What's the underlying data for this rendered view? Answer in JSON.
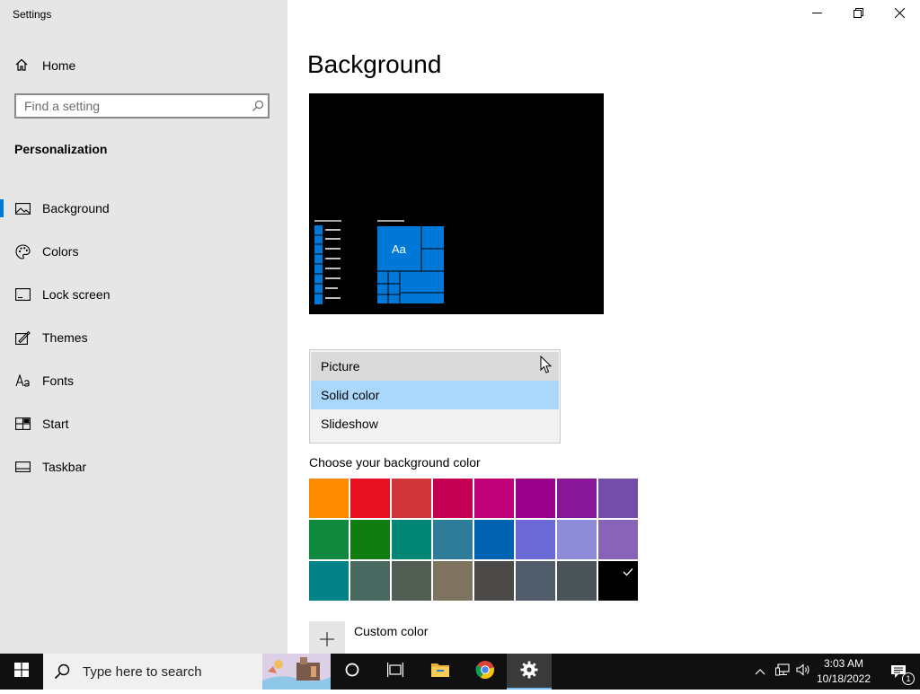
{
  "window": {
    "title": "Settings"
  },
  "sidebar": {
    "home_label": "Home",
    "search_placeholder": "Find a setting",
    "section_title": "Personalization",
    "items": [
      {
        "label": "Background",
        "icon": "picture-icon",
        "active": true
      },
      {
        "label": "Colors",
        "icon": "palette-icon",
        "active": false
      },
      {
        "label": "Lock screen",
        "icon": "lock-screen-icon",
        "active": false
      },
      {
        "label": "Themes",
        "icon": "themes-icon",
        "active": false
      },
      {
        "label": "Fonts",
        "icon": "fonts-icon",
        "active": false
      },
      {
        "label": "Start",
        "icon": "start-icon",
        "active": false
      },
      {
        "label": "Taskbar",
        "icon": "taskbar-icon",
        "active": false
      }
    ]
  },
  "main": {
    "title": "Background",
    "preview": {
      "tile_text": "Aa",
      "background": "#000000",
      "accent": "#0078d7"
    },
    "dropdown": {
      "options": [
        "Picture",
        "Solid color",
        "Slideshow"
      ],
      "selected": "Solid color",
      "hovered": "Picture"
    },
    "swatch_label": "Choose your background color",
    "swatches": [
      "#ff8c00",
      "#e81123",
      "#d13438",
      "#c30052",
      "#bf0077",
      "#9a0089",
      "#881798",
      "#744da9",
      "#10893e",
      "#107c10",
      "#018574",
      "#2d7d9a",
      "#0063b1",
      "#6b69d6",
      "#8e8cd8",
      "#8764b8",
      "#038387",
      "#486860",
      "#525e54",
      "#7e735f",
      "#4c4a48",
      "#515c6b",
      "#4a5459",
      "#000000"
    ],
    "selected_swatch": "#000000",
    "custom_color_label": "Custom color"
  },
  "taskbar": {
    "search_placeholder": "Type here to search",
    "time": "3:03 AM",
    "date": "10/18/2022",
    "notification_count": "1"
  }
}
